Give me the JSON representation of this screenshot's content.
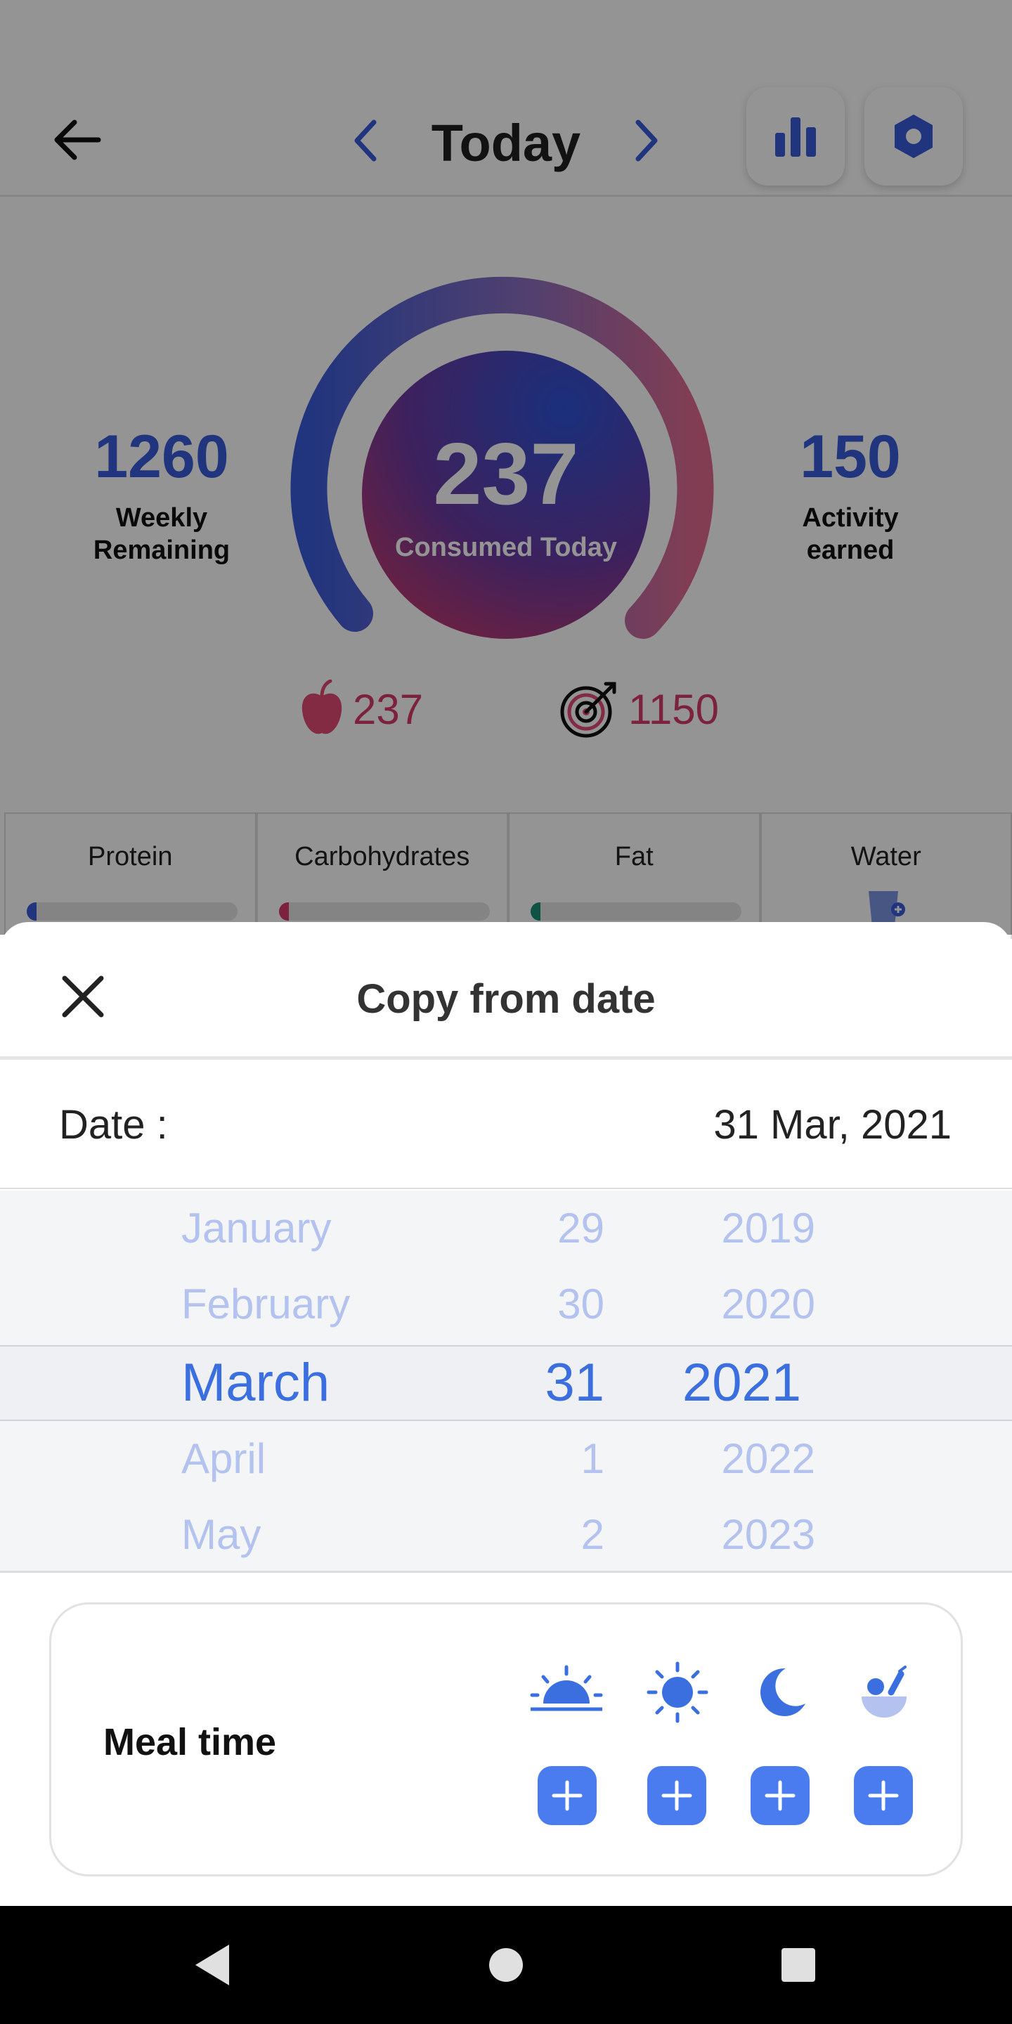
{
  "header": {
    "title": "Today"
  },
  "summary": {
    "weekly_remaining_value": "1260",
    "weekly_remaining_label": "Weekly Remaining",
    "consumed_value": "237",
    "consumed_label": "Consumed Today",
    "activity_value": "150",
    "activity_label": "Activity earned",
    "food_count": "237",
    "goal_count": "1150"
  },
  "macros": [
    {
      "label": "Protein",
      "color": "#3a5bd9"
    },
    {
      "label": "Carbohydrates",
      "color": "#d63c69"
    },
    {
      "label": "Fat",
      "color": "#1a8f7a"
    },
    {
      "label": "Water",
      "color": "#7a95e0"
    }
  ],
  "sheet": {
    "title": "Copy from date",
    "date_label": "Date :",
    "date_value": "31 Mar, 2021"
  },
  "picker": {
    "months": [
      "January",
      "February",
      "March",
      "April",
      "May"
    ],
    "days": [
      "29",
      "30",
      "31",
      "1",
      "2"
    ],
    "years": [
      "2019",
      "2020",
      "2021",
      "2022",
      "2023"
    ],
    "selected_index": 2
  },
  "meal": {
    "label": "Meal time",
    "slots": [
      "breakfast",
      "lunch",
      "dinner",
      "snack"
    ]
  },
  "colors": {
    "accent": "#4a7cf0",
    "primary_blue": "#3a5bd9",
    "pink": "#d63c69"
  }
}
